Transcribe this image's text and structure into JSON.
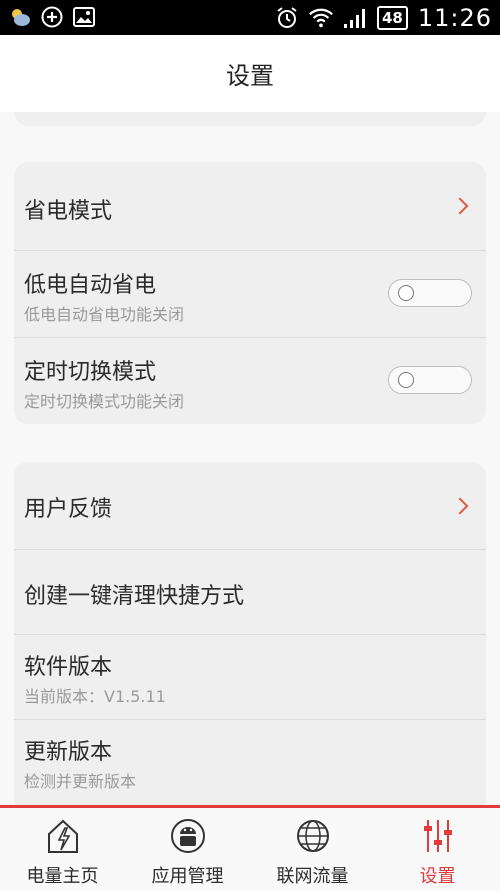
{
  "status_bar": {
    "icons_left": [
      "weather-icon",
      "plus-circle-icon",
      "image-icon"
    ],
    "battery": "48",
    "time": "11:26"
  },
  "header": {
    "title": "设置"
  },
  "sections": [
    {
      "items": [
        {
          "title": "省电模式",
          "control": "chevron"
        },
        {
          "title": "低电自动省电",
          "subtitle": "低电自动省电功能关闭",
          "control": "toggle",
          "state": "off"
        },
        {
          "title": "定时切换模式",
          "subtitle": "定时切换模式功能关闭",
          "control": "toggle",
          "state": "off"
        }
      ]
    },
    {
      "items": [
        {
          "title": "用户反馈",
          "control": "chevron"
        },
        {
          "title": "创建一键清理快捷方式"
        },
        {
          "title": "软件版本",
          "subtitle": "当前版本：V1.5.11"
        },
        {
          "title": "更新版本",
          "subtitle": "检测并更新版本"
        }
      ]
    }
  ],
  "tabbar": {
    "tabs": [
      {
        "label": "电量主页",
        "icon": "house-lightning-icon"
      },
      {
        "label": "应用管理",
        "icon": "android-icon"
      },
      {
        "label": "联网流量",
        "icon": "globe-icon"
      },
      {
        "label": "设置",
        "icon": "sliders-icon",
        "active": true
      }
    ]
  },
  "colors": {
    "accent": "#e23b3b",
    "chevron": "#e25a4a"
  }
}
